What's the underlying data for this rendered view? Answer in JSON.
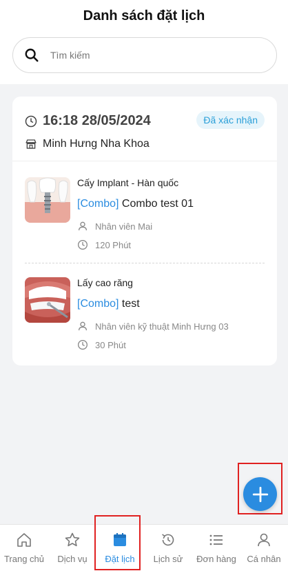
{
  "header": {
    "title": "Danh sách đặt lịch"
  },
  "search": {
    "placeholder": "Tìm kiếm",
    "value": ""
  },
  "booking": {
    "datetime": "16:18 28/05/2024",
    "status": "Đã xác nhận",
    "clinic": "Minh Hưng Nha Khoa",
    "services": [
      {
        "name": "Cấy Implant - Hàn quốc",
        "combo_tag": "[Combo]",
        "combo_name": "Combo test 01",
        "staff": "Nhân viên Mai",
        "duration": "120 Phút",
        "image": "dental-implant"
      },
      {
        "name": "Lấy cao răng",
        "combo_tag": "[Combo]",
        "combo_name": "test",
        "staff": "Nhân viên kỹ thuật Minh Hưng 03",
        "duration": "30 Phút",
        "image": "teeth-cleaning"
      }
    ]
  },
  "fab": {
    "icon": "plus-icon"
  },
  "tabbar": {
    "items": [
      {
        "label": "Trang chủ",
        "icon": "home-icon"
      },
      {
        "label": "Dịch vụ",
        "icon": "star-icon"
      },
      {
        "label": "Đặt lịch",
        "icon": "calendar-icon",
        "active": true
      },
      {
        "label": "Lịch sử",
        "icon": "history-icon"
      },
      {
        "label": "Đơn hàng",
        "icon": "list-icon"
      },
      {
        "label": "Cá nhân",
        "icon": "user-icon"
      }
    ]
  },
  "colors": {
    "accent": "#2a8ce0",
    "status_bg": "#e6f4fb",
    "status_text": "#2a9fd8",
    "highlight": "#e02020"
  }
}
